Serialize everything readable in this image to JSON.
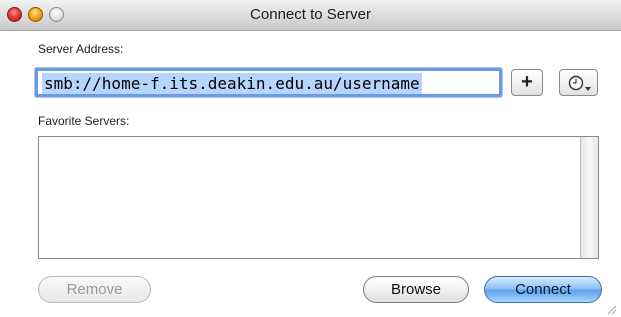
{
  "window": {
    "title": "Connect to Server"
  },
  "server_address": {
    "label": "Server Address:",
    "value": "smb://home-f.its.deakin.edu.au/username"
  },
  "address_buttons": {
    "add_label": "+"
  },
  "favorites": {
    "label": "Favorite Servers:",
    "items": []
  },
  "buttons": {
    "remove": "Remove",
    "browse": "Browse",
    "connect": "Connect"
  },
  "colors": {
    "accent": "#6c9be0",
    "selection": "#b5d5ff",
    "default_button": "#8fc2f5"
  },
  "icons": {
    "close": "close-icon",
    "minimize": "minimize-icon",
    "zoom": "zoom-icon",
    "history": "clock-dropdown-icon",
    "resize": "resize-grip-icon"
  }
}
